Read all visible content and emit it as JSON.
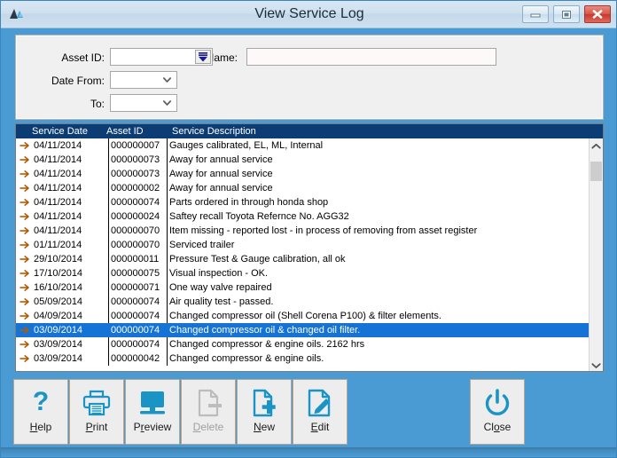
{
  "window": {
    "title": "View Service Log",
    "app_icon": "app-logo-icon",
    "controls": {
      "minimize": "minimize-icon",
      "maximize": "maximize-icon",
      "close": "close-icon"
    },
    "accent_blue": "#4a9ad4",
    "header_blue": "#0c3c74",
    "selection_blue": "#1673d6",
    "icon_teal": "#1a94c4"
  },
  "filters": {
    "asset_id": {
      "label": "Asset ID:",
      "value": "",
      "placeholder": ""
    },
    "name": {
      "label": "Name:",
      "value": "",
      "placeholder": ""
    },
    "date_from": {
      "label": "Date From:",
      "value": "",
      "placeholder": ""
    },
    "date_to": {
      "label": "To:",
      "value": "",
      "placeholder": ""
    }
  },
  "list": {
    "columns": [
      "Service Date",
      "Asset ID",
      "Service Description"
    ],
    "selected_index": 13,
    "rows": [
      {
        "date": "04/11/2014",
        "asset": "000000007",
        "desc": "Gauges calibrated, EL, ML, Internal"
      },
      {
        "date": "04/11/2014",
        "asset": "000000073",
        "desc": "Away for annual service"
      },
      {
        "date": "04/11/2014",
        "asset": "000000073",
        "desc": "Away for annual service"
      },
      {
        "date": "04/11/2014",
        "asset": "000000002",
        "desc": "Away for annual service"
      },
      {
        "date": "04/11/2014",
        "asset": "000000074",
        "desc": "Parts ordered in through honda shop"
      },
      {
        "date": "04/11/2014",
        "asset": "000000024",
        "desc": "Saftey recall Toyota Refernce No. AGG32"
      },
      {
        "date": "04/11/2014",
        "asset": "000000070",
        "desc": "Item missing - reported lost - in process of removing from asset register"
      },
      {
        "date": "01/11/2014",
        "asset": "000000070",
        "desc": "Serviced trailer"
      },
      {
        "date": "29/10/2014",
        "asset": "000000011",
        "desc": "Pressure Test & Gauge calibration, all ok"
      },
      {
        "date": "17/10/2014",
        "asset": "000000075",
        "desc": "Visual inspection - OK."
      },
      {
        "date": "16/10/2014",
        "asset": "000000071",
        "desc": "One way valve repaired"
      },
      {
        "date": "05/09/2014",
        "asset": "000000074",
        "desc": "Air quality test - passed."
      },
      {
        "date": "04/09/2014",
        "asset": "000000074",
        "desc": "Changed compressor oil (Shell Corena P100) & filter elements."
      },
      {
        "date": "03/09/2014",
        "asset": "000000074",
        "desc": "Changed compressor oil & changed oil filter."
      },
      {
        "date": "03/09/2014",
        "asset": "000000074",
        "desc": "Changed compressor & engine oils. 2162 hrs"
      },
      {
        "date": "03/09/2014",
        "asset": "000000042",
        "desc": "Changed compressor & engine oils."
      }
    ]
  },
  "toolbar": {
    "buttons": [
      {
        "id": "help",
        "label": "Help",
        "accel": "H",
        "icon": "question-mark-icon",
        "enabled": true
      },
      {
        "id": "print",
        "label": "Print",
        "accel": "P",
        "icon": "printer-icon",
        "enabled": true
      },
      {
        "id": "preview",
        "label": "Preview",
        "accel": "r",
        "icon": "monitor-icon",
        "enabled": true
      },
      {
        "id": "delete",
        "label": "Delete",
        "accel": "D",
        "icon": "delete-document-icon",
        "enabled": false
      },
      {
        "id": "new",
        "label": "New",
        "accel": "N",
        "icon": "new-document-icon",
        "enabled": true
      },
      {
        "id": "edit",
        "label": "Edit",
        "accel": "E",
        "icon": "edit-pencil-icon",
        "enabled": true
      },
      {
        "id": "close",
        "label": "Close",
        "accel": "o",
        "icon": "power-icon",
        "enabled": true
      }
    ]
  }
}
